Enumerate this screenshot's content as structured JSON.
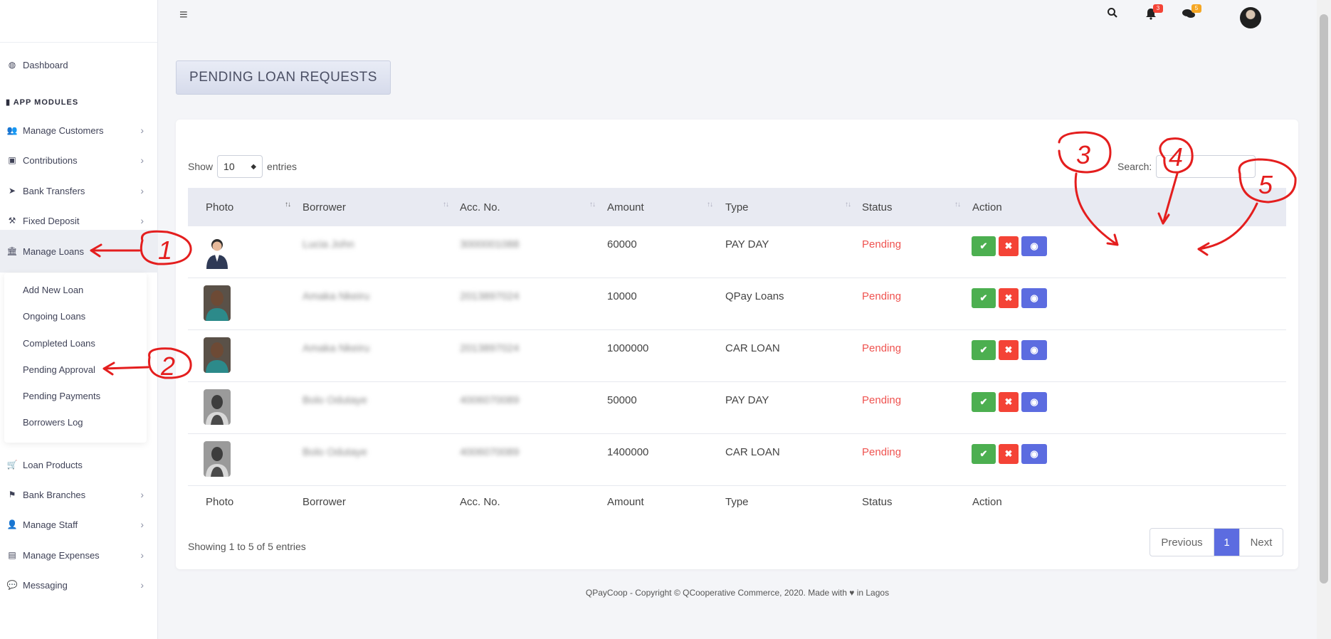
{
  "sidebar": {
    "dashboard": "Dashboard",
    "heading": "APP MODULES",
    "items": [
      {
        "label": "Manage Customers",
        "icon": "users-icon",
        "chev": "›"
      },
      {
        "label": "Contributions",
        "icon": "money-icon",
        "chev": "›"
      },
      {
        "label": "Bank Transfers",
        "icon": "send-icon",
        "chev": "›"
      },
      {
        "label": "Fixed Deposit",
        "icon": "gavel-icon",
        "chev": "›"
      },
      {
        "label": "Manage Loans",
        "icon": "bank-icon",
        "chev": ""
      }
    ],
    "sub_items": [
      "Add New Loan",
      "Ongoing Loans",
      "Completed Loans",
      "Pending Approval",
      "Pending Payments",
      "Borrowers Log"
    ],
    "items_after": [
      {
        "label": "Loan Products",
        "icon": "cart-icon",
        "chev": ""
      },
      {
        "label": "Bank Branches",
        "icon": "flag-icon",
        "chev": "›"
      },
      {
        "label": "Manage Staff",
        "icon": "user-icon",
        "chev": "›"
      },
      {
        "label": "Manage Expenses",
        "icon": "receipt-icon",
        "chev": "›"
      },
      {
        "label": "Messaging",
        "icon": "chat-icon",
        "chev": "›"
      }
    ]
  },
  "topbar": {
    "notif_badge": "3",
    "msg_badge": "5"
  },
  "page": {
    "title": "PENDING LOAN REQUESTS"
  },
  "table": {
    "show_label": "Show",
    "entries_value": "10",
    "entries_label": "entries",
    "search_label": "Search:",
    "columns": [
      "Photo",
      "Borrower",
      "Acc. No.",
      "Amount",
      "Type",
      "Status",
      "Action"
    ],
    "rows": [
      {
        "borrower": "Lucia John",
        "acc": "3000001088",
        "amount": "60000",
        "type": "PAY DAY",
        "status": "Pending"
      },
      {
        "borrower": "Amaka Nkeiru",
        "acc": "2013897024",
        "amount": "10000",
        "type": "QPay Loans",
        "status": "Pending"
      },
      {
        "borrower": "Amaka Nkeiru",
        "acc": "2013897024",
        "amount": "1000000",
        "type": "CAR LOAN",
        "status": "Pending"
      },
      {
        "borrower": "Bolo Odutaye",
        "acc": "4006070089",
        "amount": "50000",
        "type": "PAY DAY",
        "status": "Pending"
      },
      {
        "borrower": "Bolo Odutaye",
        "acc": "4006070089",
        "amount": "1400000",
        "type": "CAR LOAN",
        "status": "Pending"
      }
    ],
    "info": "Showing 1 to 5 of 5 entries",
    "prev": "Previous",
    "page": "1",
    "next": "Next"
  },
  "footer": "QPayCoop - Copyright © QCooperative Commerce, 2020. Made with ♥ in Lagos",
  "annotations": [
    "1",
    "2",
    "3",
    "4",
    "5"
  ]
}
